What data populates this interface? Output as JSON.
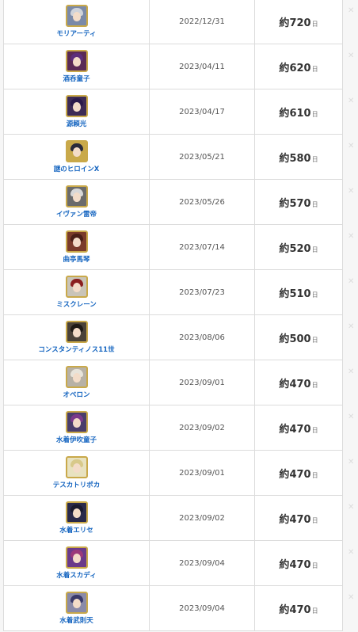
{
  "rows": [
    {
      "name": "モリアーティ",
      "date": "2022/12/31",
      "days_prefix": "約",
      "days": "720",
      "unit": "日",
      "avatar_bg": "#7b8aa8",
      "hair": "#cfd3da"
    },
    {
      "name": "酒呑童子",
      "date": "2023/04/11",
      "days_prefix": "約",
      "days": "620",
      "unit": "日",
      "avatar_bg": "#5a2a55",
      "hair": "#5c2e7a"
    },
    {
      "name": "源頼光",
      "date": "2023/04/17",
      "days_prefix": "約",
      "days": "610",
      "unit": "日",
      "avatar_bg": "#3d2b55",
      "hair": "#2a1a4a"
    },
    {
      "name": "謎のヒロインX",
      "date": "2023/05/21",
      "days_prefix": "約",
      "days": "580",
      "unit": "日",
      "avatar_bg": "#c9a94a",
      "hair": "#2b2b3b"
    },
    {
      "name": "イヴァン雷帝",
      "date": "2023/05/26",
      "days_prefix": "約",
      "days": "570",
      "unit": "日",
      "avatar_bg": "#6b6b6b",
      "hair": "#d8d8d8"
    },
    {
      "name": "曲亭馬琴",
      "date": "2023/07/14",
      "days_prefix": "約",
      "days": "520",
      "unit": "日",
      "avatar_bg": "#7a3b2a",
      "hair": "#4a1f17"
    },
    {
      "name": "ミスクレーン",
      "date": "2023/07/23",
      "days_prefix": "約",
      "days": "510",
      "unit": "日",
      "avatar_bg": "#c9c4b8",
      "hair": "#8a1f1f"
    },
    {
      "name": "コンスタンティノス11世",
      "date": "2023/08/06",
      "days_prefix": "約",
      "days": "500",
      "unit": "日",
      "avatar_bg": "#4a4238",
      "hair": "#1e1a16"
    },
    {
      "name": "オベロン",
      "date": "2023/09/01",
      "days_prefix": "約",
      "days": "470",
      "unit": "日",
      "avatar_bg": "#b7b1a6",
      "hair": "#e8e4da"
    },
    {
      "name": "水着伊吹童子",
      "date": "2023/09/02",
      "days_prefix": "約",
      "days": "470",
      "unit": "日",
      "avatar_bg": "#4a3e6b",
      "hair": "#7b3a8a"
    },
    {
      "name": "テスカトリポカ",
      "date": "2023/09/01",
      "days_prefix": "約",
      "days": "470",
      "unit": "日",
      "avatar_bg": "#e8e2c0",
      "hair": "#d8c98a"
    },
    {
      "name": "水着エリセ",
      "date": "2023/09/02",
      "days_prefix": "約",
      "days": "470",
      "unit": "日",
      "avatar_bg": "#2a2a4a",
      "hair": "#1a1a2e"
    },
    {
      "name": "水着スカディ",
      "date": "2023/09/04",
      "days_prefix": "約",
      "days": "470",
      "unit": "日",
      "avatar_bg": "#6a3a8a",
      "hair": "#9a3a7a"
    },
    {
      "name": "水着武則天",
      "date": "2023/09/04",
      "days_prefix": "約",
      "days": "470",
      "unit": "日",
      "avatar_bg": "#8a8aa8",
      "hair": "#3a3a6a"
    }
  ]
}
